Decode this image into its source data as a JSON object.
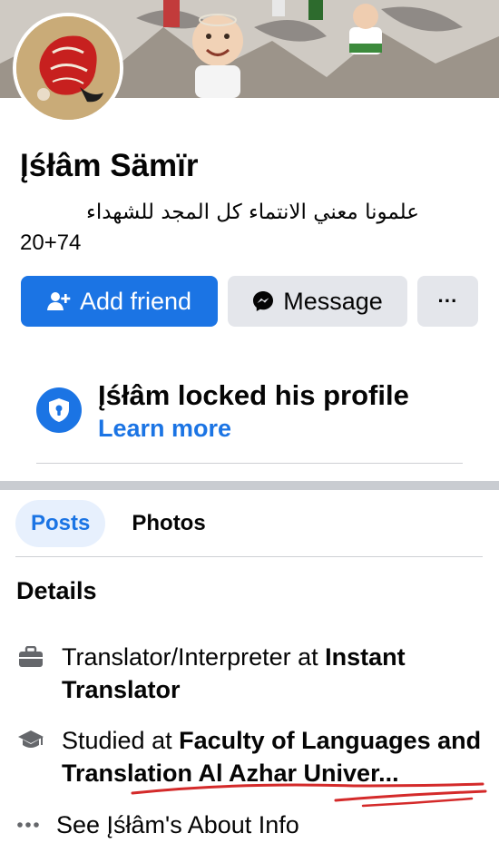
{
  "profile": {
    "name": "Įśłâm Sämïr",
    "bio_arabic": "علمونا معني الانتماء كل المجد للشهداء",
    "bio_number": "20+74"
  },
  "actions": {
    "add_friend": "Add friend",
    "message": "Message",
    "more": "···"
  },
  "lock_notice": {
    "title": "Įśłâm locked his profile",
    "link": "Learn more"
  },
  "tabs": [
    {
      "label": "Posts",
      "active": true
    },
    {
      "label": "Photos",
      "active": false
    }
  ],
  "details": {
    "title": "Details",
    "work": {
      "prefix": "Translator/Interpreter at ",
      "org": "Instant Translator"
    },
    "education": {
      "prefix": "Studied at ",
      "org": "Faculty of Languages and Translation Al Azhar Univer..."
    },
    "about_link": "See Įśłâm's About Info"
  },
  "colors": {
    "accent": "#1b74e4",
    "button_secondary": "#e4e6eb",
    "annotation_red": "#d42a2a"
  },
  "icons": [
    "add-person-icon",
    "messenger-icon",
    "more-icon",
    "shield-lock-icon",
    "briefcase-icon",
    "graduation-cap-icon",
    "ellipsis-icon"
  ]
}
